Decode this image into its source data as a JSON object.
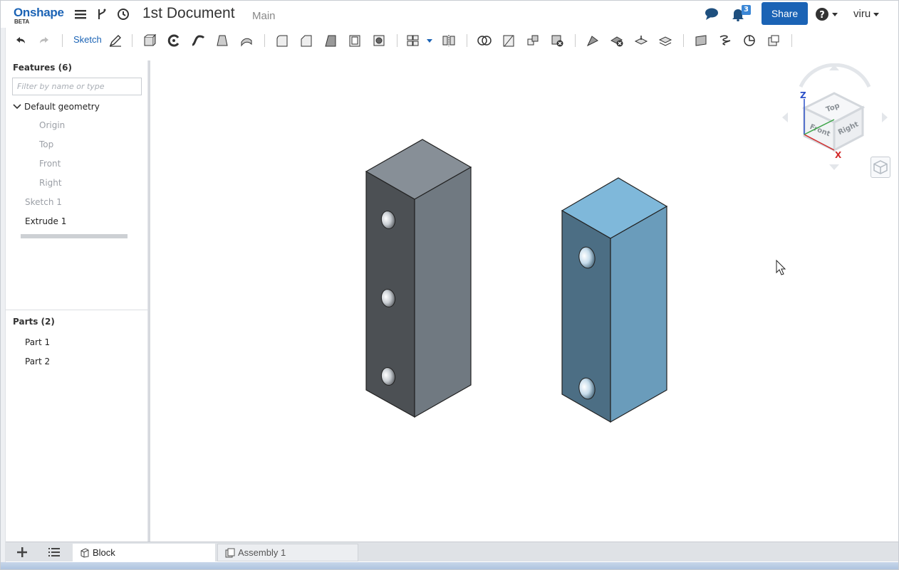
{
  "header": {
    "logo_text": "Onshape",
    "logo_sub": "BETA",
    "menu_icon": "hamburger-icon",
    "versions_icon": "branch-icon",
    "history_icon": "clock-icon",
    "document_title": "1st Document",
    "branch_name": "Main",
    "comments_icon": "chat-icon",
    "notifications_icon": "bell-icon",
    "notifications_count": "3",
    "share_label": "Share",
    "help_icon": "help-icon",
    "user_name": "viru",
    "accent": "#1b63b5"
  },
  "toolbar": {
    "sketch_label": "Sketch",
    "tools": [
      "undo-icon",
      "redo-icon",
      "sketch-pencil-icon",
      "extrude-icon",
      "revolve-icon",
      "sweep-icon",
      "loft-icon",
      "thicken-icon",
      "fillet-icon",
      "chamfer-icon",
      "draft-icon",
      "shell-icon",
      "hole-icon",
      "pattern-icon",
      "mirror-icon",
      "boolean-icon",
      "split-icon",
      "transform-icon",
      "delete-part-icon",
      "modify-fillet-icon",
      "delete-face-icon",
      "move-face-icon",
      "replace-face-icon",
      "plane-icon",
      "helix-icon",
      "mate-connector-icon",
      "variable-icon"
    ]
  },
  "left_panel": {
    "features_heading": "Features (6)",
    "filter_placeholder": "Filter by name or type",
    "default_geometry_label": "Default geometry",
    "default_geometry_items": [
      "Origin",
      "Top",
      "Front",
      "Right"
    ],
    "features": [
      "Sketch 1",
      "Extrude 1"
    ],
    "parts_heading": "Parts (2)",
    "parts": [
      "Part 1",
      "Part 2"
    ]
  },
  "view_cube": {
    "axis_z": "Z",
    "axis_x": "X",
    "face_top": "Top",
    "face_front": "Front",
    "face_right": "Right",
    "home_icon": "home-view-cube-icon"
  },
  "bottom_tabs": {
    "add_icon": "plus-icon",
    "list_icon": "list-icon",
    "tabs": [
      {
        "label": "Block",
        "icon": "part-studio-icon",
        "active": true
      },
      {
        "label": "Assembly 1",
        "icon": "assembly-icon",
        "active": false
      }
    ]
  },
  "scene": {
    "part1_colors": {
      "top": "#878f97",
      "left": "#4c5054",
      "right": "#707981"
    },
    "part2_colors": {
      "top": "#7fb8da",
      "left": "#4c6e84",
      "right": "#6a9cbb"
    }
  }
}
